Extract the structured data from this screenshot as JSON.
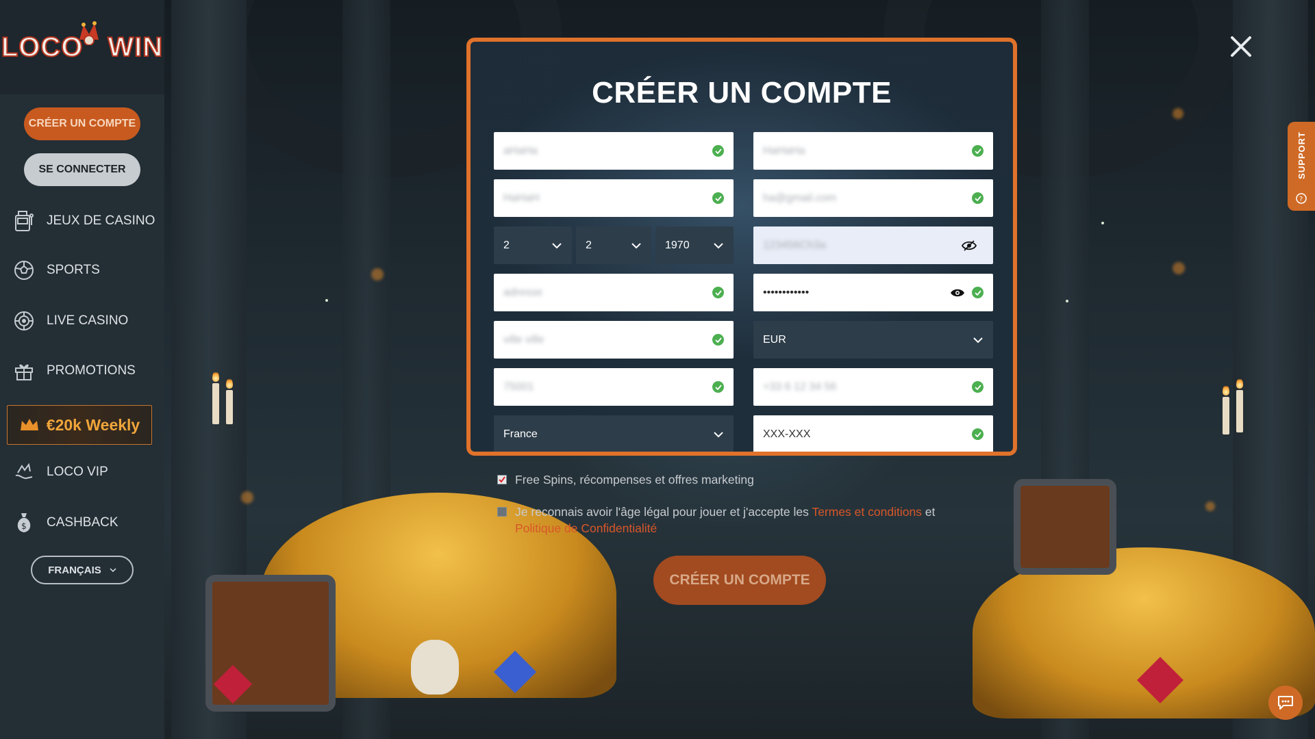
{
  "brand": {
    "logo_left": "LOCO",
    "logo_right": "WIN",
    "accent": "#e0722b",
    "button_orange": "#c85a1f"
  },
  "sidebar": {
    "signup_label": "CRÉER UN COMPTE",
    "login_label": "SE CONNECTER",
    "items": [
      {
        "label": "JEUX DE CASINO",
        "icon": "slot-machine-icon"
      },
      {
        "label": "SPORTS",
        "icon": "soccer-ball-icon"
      },
      {
        "label": "LIVE CASINO",
        "icon": "roulette-icon"
      },
      {
        "label": "PROMOTIONS",
        "icon": "gift-icon"
      },
      {
        "label": "LOCO VIP",
        "icon": "vip-hand-icon"
      },
      {
        "label": "CASHBACK",
        "icon": "money-bag-icon"
      }
    ],
    "promo_banner": "€20k Weekly",
    "language": "FRANÇAIS"
  },
  "support": {
    "label": "SUPPORT"
  },
  "modal": {
    "title": "CRÉER UN COMPTE",
    "fields": {
      "first_name": "aHaHa",
      "last_name": "HaHaHa",
      "username": "HaHaH",
      "email": "ha@gmail.com",
      "birth_day": "2",
      "birth_month": "2",
      "birth_year": "1970",
      "password_plain": "123456Ch3a",
      "address": "adresse",
      "password_masked": "••••••••••••",
      "city": "ville ville",
      "currency": "EUR",
      "postal_code": "75001",
      "phone": "+33 6 12 34 56",
      "country": "France",
      "promo_code_placeholder": "XXX-XXX"
    }
  },
  "consent": {
    "marketing": "Free Spins, récompenses et offres marketing",
    "legal_prefix": "Je reconnais avoir l'âge légal pour jouer et j'accepte les ",
    "terms_link": "Termes et conditions",
    "legal_and": " et",
    "privacy_link": "Politique de Confidentialité"
  },
  "submit_label": "CRÉER UN COMPTE"
}
